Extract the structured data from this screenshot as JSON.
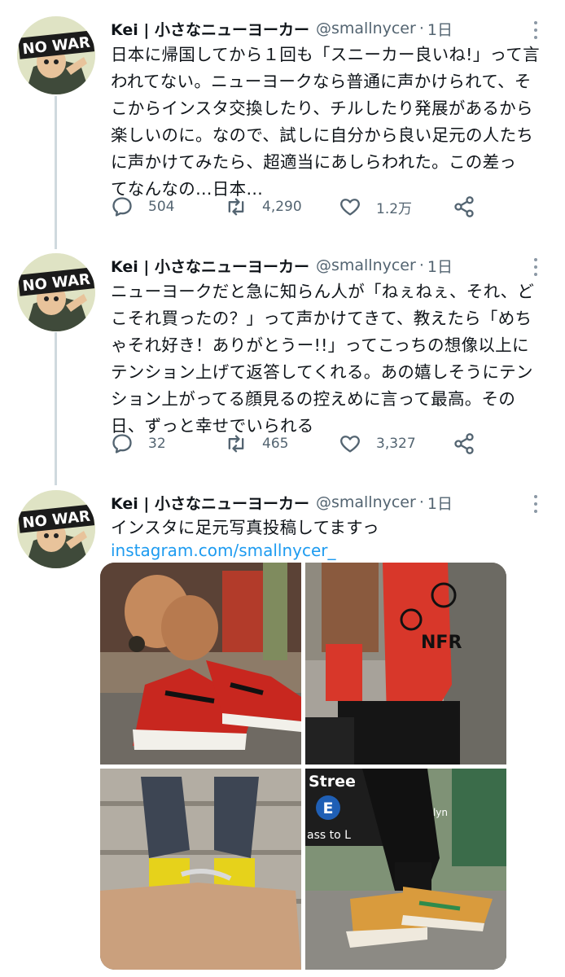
{
  "avatar": {
    "badge_text": "NO WAR"
  },
  "tweets": [
    {
      "name": "Kei | 小さなニューヨーカー",
      "handle": "@smallnycer",
      "time": "1日",
      "lines": [
        "日本に帰国してから１回も「スニーカー良いね!」って言",
        "われてない。ニューヨークなら普通に声かけられて、そ",
        "こからインスタ交換したり、チルしたり発展があるから",
        "楽しいのに。なので、試しに自分から良い足元の人たち",
        "に声かけてみたら、超適当にあしらわれた。この差っ",
        "てなんなの…日本…"
      ],
      "replies": "504",
      "retweets": "4,290",
      "likes": "1.2万"
    },
    {
      "name": "Kei | 小さなニューヨーカー",
      "handle": "@smallnycer",
      "time": "1日",
      "lines": [
        "ニューヨークだと急に知らん人が「ねぇねぇ、それ、ど",
        "こそれ買ったの？」って声かけてきて、教えたら「めち",
        "ゃそれ好き！ありがとうー!!」ってこっちの想像以上に",
        "テンション上げて返答してくれる。あの嬉しそうにテン",
        "ション上がってる顔見るの控えめに言って最高。その",
        "日、ずっと幸せでいられる"
      ],
      "replies": "32",
      "retweets": "465",
      "likes": "3,327"
    },
    {
      "name": "Kei | 小さなニューヨーカー",
      "handle": "@smallnycer",
      "time": "1日",
      "lines": [
        "インスタに足元写真投稿してますっ"
      ],
      "link": "instagram.com/smallnycer_"
    }
  ],
  "photos": {
    "sign_street": "Stree",
    "sign_line": "E",
    "sign_text": "ass to L",
    "sign_brooklyn": "klyn",
    "sock_text": "NFR"
  },
  "icons": [
    "reply-icon",
    "retweet-icon",
    "like-icon",
    "share-icon",
    "more-icon"
  ],
  "colors": {
    "accent": "#1d9bf0",
    "muted": "#536471",
    "thread": "#cfd9de"
  }
}
